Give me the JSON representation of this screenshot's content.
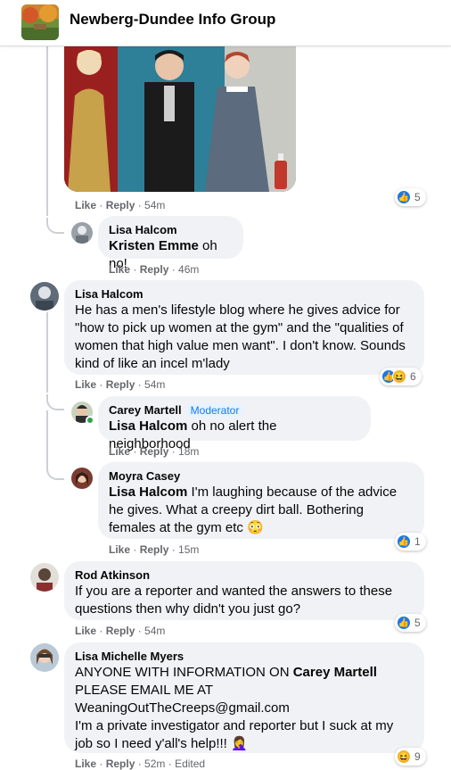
{
  "header": {
    "group_name": "Newberg-Dundee Info Group"
  },
  "actions": {
    "like": "Like",
    "reply": "Reply",
    "sep": " · "
  },
  "colors": {
    "like_blue": "#1877f2",
    "haha_yellow": "#f7b125",
    "bubble_bg": "#f0f2f5",
    "muted": "#65676b"
  },
  "photo_post": {
    "time": "54m",
    "reaction_icons": [
      "like-icon"
    ],
    "reaction_count": "5"
  },
  "comments": [
    {
      "author": "Lisa Halcom",
      "mention": "Kristen Emme",
      "text": " oh no!",
      "time": "46m"
    },
    {
      "author": "Lisa Halcom",
      "text": "He has a men's lifestyle blog where he gives advice for \"how to pick up women at the gym\" and the \"qualities of women that high value men want\". I don't know. Sounds kind of like an incel m'lady",
      "time": "54m",
      "reaction_icons": [
        "like-icon",
        "haha-icon"
      ],
      "reaction_count": "6"
    },
    {
      "author": "Carey Martell",
      "badge": "Moderator",
      "mention": "Lisa Halcom",
      "text": " oh no alert the neighborhood",
      "time": "18m"
    },
    {
      "author": "Moyra Casey",
      "mention": "Lisa Halcom",
      "text": " I'm laughing because of the advice he gives. What a creepy dirt ball. Bothering females at the gym etc 😳",
      "time": "15m",
      "reaction_icons": [
        "like-icon"
      ],
      "reaction_count": "1"
    },
    {
      "author": "Rod Atkinson",
      "text": "If you are a reporter and wanted the answers to these questions then why didn't you just go?",
      "time": "54m",
      "reaction_icons": [
        "like-icon"
      ],
      "reaction_count": "5"
    },
    {
      "author": "Lisa Michelle Myers",
      "text_a": "ANYONE WITH INFORMATION ON ",
      "mention": "Carey Martell",
      "text_b": " PLEASE EMAIL ME AT\nWeaningOutTheCreeps@gmail.com\nI'm a private investigator and reporter but I suck at my job so I need y'all's help!!! 🤦‍♀️",
      "time": "52m",
      "edited": "Edited",
      "reaction_icons": [
        "haha-icon"
      ],
      "reaction_count": "9"
    }
  ]
}
